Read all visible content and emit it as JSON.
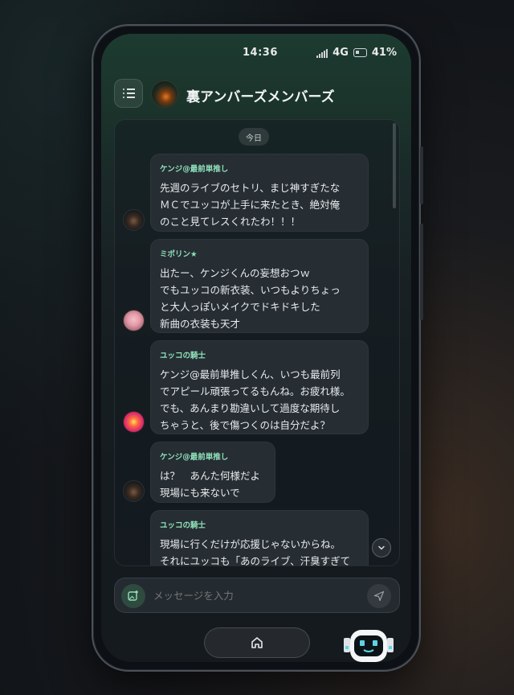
{
  "status_bar": {
    "time": "14:36",
    "network": "4G",
    "battery": "41%"
  },
  "header": {
    "title": "裏アンバーズメンバーズ"
  },
  "chat": {
    "date_label": "今日",
    "messages": [
      {
        "sender": "ケンジ@最前単推し",
        "avatar": "kenji-avatar",
        "text": "先週のライブのセトリ、まじ神すぎたな\nＭＣでユッコが上手に来たとき、絶対俺\nのこと見てレスくれたわ！！！"
      },
      {
        "sender": "ミポリン★",
        "avatar": "mipo-avatar",
        "text": "出たー、ケンジくんの妄想おつｗ\nでもユッコの新衣装、いつもよりちょっ\nと大人っぽいメイクでドキドキした\n新曲の衣装も天才"
      },
      {
        "sender": "ユッコの騎士",
        "avatar": "yukko-knight-avatar",
        "text": "ケンジ@最前単推しくん、いつも最前列\nでアピール頑張ってるもんね。お疲れ様。\nでも、あんまり勘違いして過度な期待し\nちゃうと、後で傷つくのは自分だよ？"
      },
      {
        "sender": "ケンジ@最前単推し",
        "avatar": "kenji-avatar",
        "text": "は？　あんた何様だよ\n現場にも来ないで"
      },
      {
        "sender": "ユッコの騎士",
        "avatar": "yukko-knight-avatar",
        "text": "現場に行くだけが応援じゃないからね。\nそれにユッコも「あのライブ、汗臭すぎて"
      }
    ]
  },
  "composer": {
    "placeholder": "メッセージを入力"
  },
  "colors": {
    "accent": "#8fe0b9",
    "bubble": "#262d33",
    "header_bg": "#1d3b30"
  },
  "icons": [
    "menu-icon",
    "image-add-icon",
    "send-icon",
    "chevron-down-icon",
    "home-icon",
    "robot-mascot-icon"
  ]
}
